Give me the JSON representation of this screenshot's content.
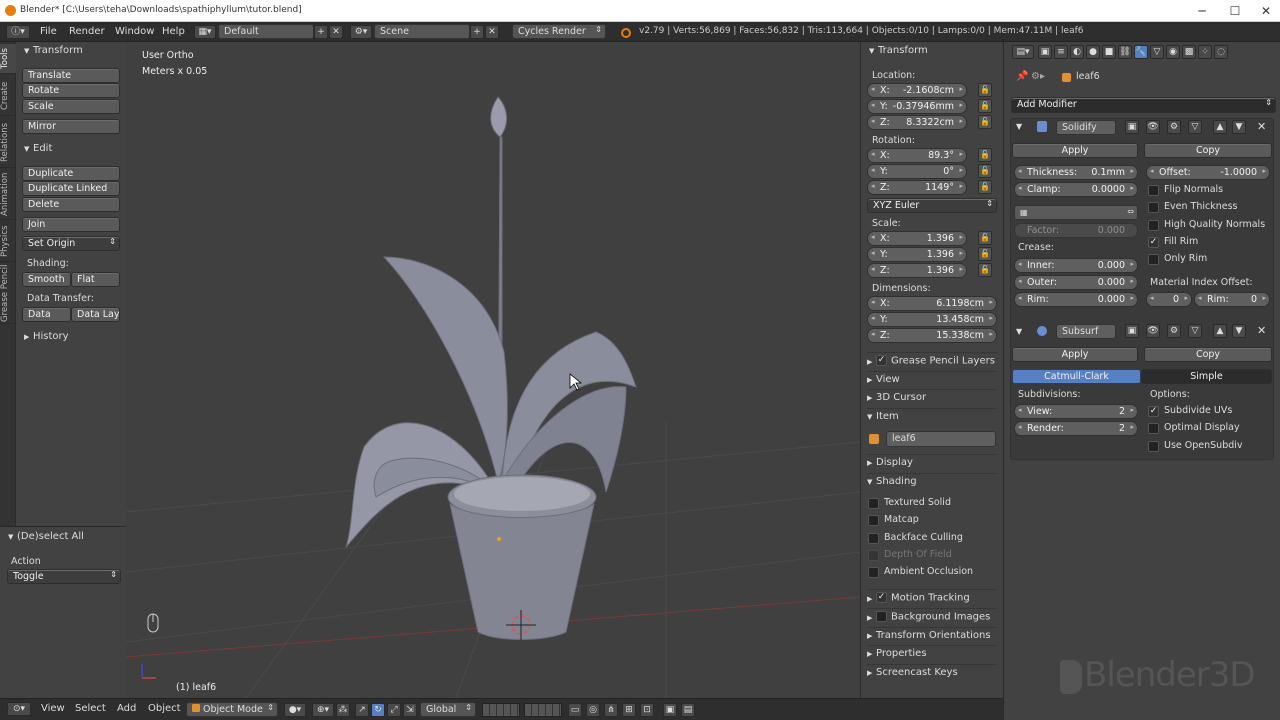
{
  "titlebar": {
    "title": "Blender* [C:\\Users\\teha\\Downloads\\spathiphyllum\\tutor.blend]",
    "minimize": "─",
    "maximize": "☐",
    "close": "✕"
  },
  "menubar": {
    "items": [
      "File",
      "Render",
      "Window",
      "Help"
    ],
    "layout": "Default",
    "scene": "Scene",
    "engine": "Cycles Render",
    "stats": "v2.79 | Verts:56,869 | Faces:56,832 | Tris:113,664 | Objects:0/10 | Lamps:0/0 | Mem:47.11M | leaf6"
  },
  "tooltabs": [
    "Tools",
    "Create",
    "Relations",
    "Animation",
    "Physics",
    "Grease Pencil"
  ],
  "toolshelf": {
    "transform_header": "Transform",
    "transform_buttons": [
      "Translate",
      "Rotate",
      "Scale"
    ],
    "mirror": "Mirror",
    "edit_header": "Edit",
    "edit_buttons": [
      "Duplicate",
      "Duplicate Linked",
      "Delete"
    ],
    "join": "Join",
    "set_origin": "Set Origin",
    "shading_label": "Shading:",
    "smooth": "Smooth",
    "flat": "Flat",
    "data_transfer_label": "Data Transfer:",
    "data": "Data",
    "data_layo": "Data Layo",
    "history": "History"
  },
  "operator": {
    "header": "(De)select All",
    "action_label": "Action",
    "action_value": "Toggle"
  },
  "viewport": {
    "view_name": "User Ortho",
    "units": "Meters x 0.05",
    "object_label": "(1) leaf6"
  },
  "npanel": {
    "transform_header": "Transform",
    "location_label": "Location:",
    "location": [
      {
        "k": "X:",
        "v": "-2.1608cm"
      },
      {
        "k": "Y:",
        "v": "-0.37946mm"
      },
      {
        "k": "Z:",
        "v": "8.3322cm"
      }
    ],
    "rotation_label": "Rotation:",
    "rotation": [
      {
        "k": "X:",
        "v": "89.3°"
      },
      {
        "k": "Y:",
        "v": "0°"
      },
      {
        "k": "Z:",
        "v": "1149°"
      }
    ],
    "rotation_mode": "XYZ Euler",
    "scale_label": "Scale:",
    "scale": [
      {
        "k": "X:",
        "v": "1.396"
      },
      {
        "k": "Y:",
        "v": "1.396"
      },
      {
        "k": "Z:",
        "v": "1.396"
      }
    ],
    "dimensions_label": "Dimensions:",
    "dimensions": [
      {
        "k": "X:",
        "v": "6.1198cm"
      },
      {
        "k": "Y:",
        "v": "13.458cm"
      },
      {
        "k": "Z:",
        "v": "15.338cm"
      }
    ],
    "grease_pencil_layers": "Grease Pencil Layers",
    "view": "View",
    "cursor": "3D Cursor",
    "item": "Item",
    "item_name": "leaf6",
    "display": "Display",
    "shading": "Shading",
    "shading_opts": [
      {
        "label": "Textured Solid",
        "checked": false,
        "enabled": true
      },
      {
        "label": "Matcap",
        "checked": false,
        "enabled": true
      },
      {
        "label": "Backface Culling",
        "checked": false,
        "enabled": true
      },
      {
        "label": "Depth Of Field",
        "checked": false,
        "enabled": false
      },
      {
        "label": "Ambient Occlusion",
        "checked": false,
        "enabled": true
      }
    ],
    "motion_tracking": "Motion Tracking",
    "background_images": "Background Images",
    "transform_orientations": "Transform Orientations",
    "properties": "Properties",
    "screencast_keys": "Screencast Keys"
  },
  "props": {
    "breadcrumb": "leaf6",
    "add_modifier": "Add Modifier",
    "solidify": {
      "name": "Solidify",
      "apply": "Apply",
      "copy": "Copy",
      "thickness_k": "Thickness:",
      "thickness_v": "0.1mm",
      "offset_k": "Offset:",
      "offset_v": "-1.0000",
      "clamp_k": "Clamp:",
      "clamp_v": "0.0000",
      "factor_k": "Factor:",
      "factor_v": "0.000",
      "crease_label": "Crease:",
      "inner_k": "Inner:",
      "inner_v": "0.000",
      "outer_k": "Outer:",
      "outer_v": "0.000",
      "rim_k": "Rim:",
      "rim_v": "0.000",
      "material_index_label": "Material Index Offset:",
      "mat_v": "0",
      "rim2_k": "Rim:",
      "rim2_v": "0",
      "checks": [
        {
          "label": "Flip Normals",
          "checked": false
        },
        {
          "label": "Even Thickness",
          "checked": false
        },
        {
          "label": "High Quality Normals",
          "checked": false
        },
        {
          "label": "Fill Rim",
          "checked": true
        },
        {
          "label": "Only Rim",
          "checked": false
        }
      ]
    },
    "subsurf": {
      "name": "Subsurf",
      "apply": "Apply",
      "copy": "Copy",
      "catmull": "Catmull-Clark",
      "simple": "Simple",
      "subdivisions_label": "Subdivisions:",
      "options_label": "Options:",
      "view_k": "View:",
      "view_v": "2",
      "render_k": "Render:",
      "render_v": "2",
      "checks": [
        {
          "label": "Subdivide UVs",
          "checked": true
        },
        {
          "label": "Optimal Display",
          "checked": false
        },
        {
          "label": "Use OpenSubdiv",
          "checked": false
        }
      ]
    }
  },
  "bottombar": {
    "items": [
      "View",
      "Select",
      "Add",
      "Object"
    ],
    "mode": "Object Mode",
    "orientation": "Global"
  },
  "watermark": "Blender3D",
  "colors": {
    "accent_blue": "#5680c2",
    "header_bg": "#2e2e2e",
    "panel_bg": "#424242",
    "viewport_bg": "#404040"
  }
}
